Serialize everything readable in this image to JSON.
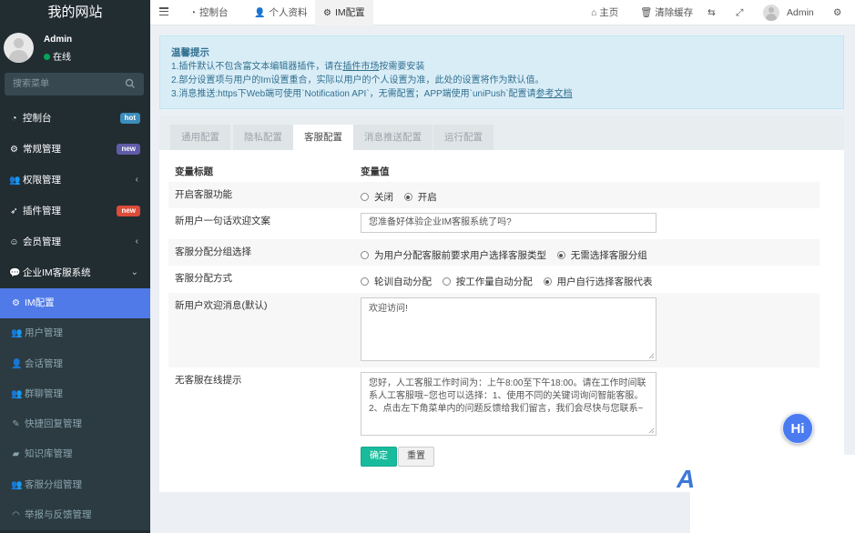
{
  "brand": "我的网站",
  "user": {
    "name": "Admin",
    "status": "在线"
  },
  "search": {
    "placeholder": "搜索菜单"
  },
  "menu": [
    {
      "label": "控制台",
      "badge": "hot",
      "badge_color": "#3c8dbc"
    },
    {
      "label": "常规管理",
      "badge": "new",
      "badge_color": "#605ca8"
    },
    {
      "label": "权限管理",
      "chevron": "‹"
    },
    {
      "label": "插件管理",
      "badge": "new",
      "badge_color": "#dd4b39"
    },
    {
      "label": "会员管理",
      "chevron": "‹"
    },
    {
      "label": "企业IM客服系统",
      "chevron": "⌄"
    }
  ],
  "submenu": [
    {
      "label": "IM配置",
      "active": true
    },
    {
      "label": "用户管理"
    },
    {
      "label": "会话管理"
    },
    {
      "label": "群聊管理"
    },
    {
      "label": "快捷回复管理"
    },
    {
      "label": "知识库管理"
    },
    {
      "label": "客服分组管理"
    },
    {
      "label": "举报与反馈管理"
    }
  ],
  "navbar": {
    "tabs": [
      {
        "label": "控制台"
      },
      {
        "label": "个人资料"
      },
      {
        "label": "IM配置",
        "active": true
      }
    ],
    "home": "主页",
    "clear_cache": "清除缓存",
    "admin": "Admin"
  },
  "alert": {
    "title": "温馨提示",
    "line1_pre": "1.插件默认不包含富文本编辑器插件，请在",
    "line1_link": "插件市场",
    "line1_post": "按需要安装",
    "line2": "2.部分设置项与用户的Im设置重合，实际以用户的个人设置为准，此处的设置将作为默认值。",
    "line3_pre": "3.消息推送:https下Web端可使用`Notification API`，无需配置；APP端使用`uniPush`配置请",
    "line3_link": "参考文档"
  },
  "config_tabs": [
    {
      "label": "通用配置"
    },
    {
      "label": "隐私配置"
    },
    {
      "label": "客服配置",
      "active": true
    },
    {
      "label": "消息推送配置"
    },
    {
      "label": "运行配置"
    }
  ],
  "form": {
    "header_title": "变量标题",
    "header_value": "变量值",
    "rows": {
      "enable": {
        "label": "开启客服功能",
        "options": [
          "关闭",
          "开启"
        ],
        "selected": 1
      },
      "welcome": {
        "label": "新用户一句话欢迎文案",
        "value": "您准备好体验企业IM客服系统了吗?"
      },
      "group": {
        "label": "客服分配分组选择",
        "options": [
          "为用户分配客服前要求用户选择客服类型",
          "无需选择客服分组"
        ],
        "selected": 1
      },
      "assign": {
        "label": "客服分配方式",
        "options": [
          "轮训自动分配",
          "按工作量自动分配",
          "用户自行选择客服代表"
        ],
        "selected": 2
      },
      "welcome_msg": {
        "label": "新用户欢迎消息(默认)",
        "value": "欢迎访问!"
      },
      "offline": {
        "label": "无客服在线提示",
        "value": "您好，人工客服工作时间为：上午8:00至下午18:00。请在工作时间联系人工客服哦~您也可以选择：1、使用不同的关键词询问智能客服。2、点击左下角菜单内的问题反馈给我们留言，我们会尽快与您联系~"
      }
    },
    "submit": "确定",
    "reset": "重置"
  },
  "chat_bubble": "Hi",
  "colors": {
    "sidebar": "#222d32",
    "active": "#4f7ae8",
    "primary_button": "#18bc9c",
    "alert_bg": "#d9edf7"
  }
}
